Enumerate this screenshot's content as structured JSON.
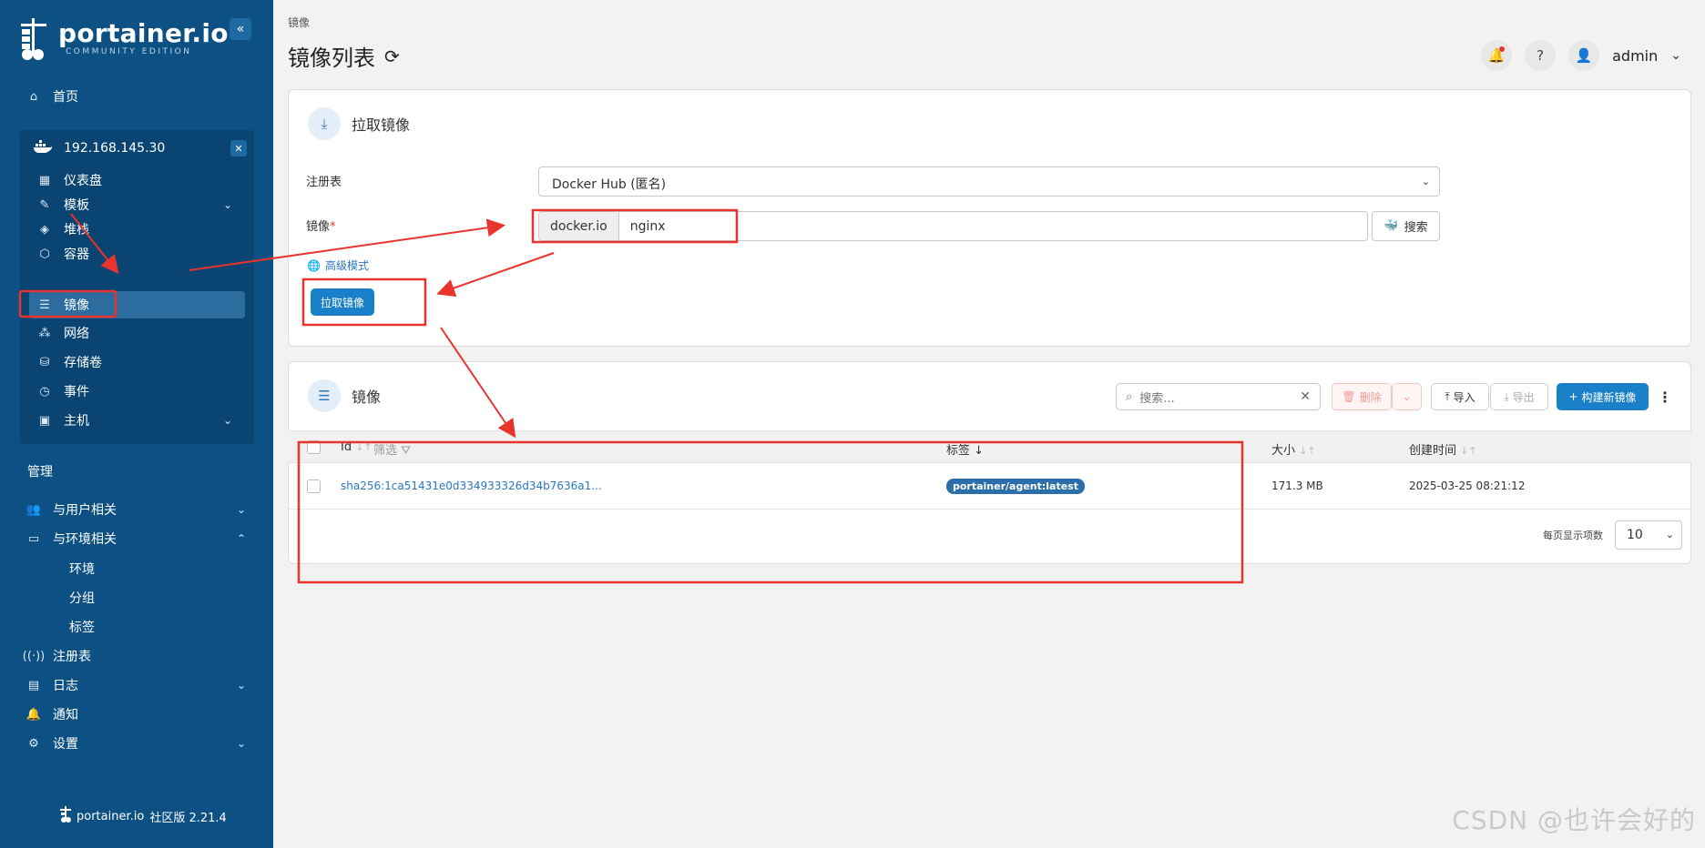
{
  "app": {
    "brand": "portainer.io",
    "edition": "COMMUNITY EDITION",
    "footer_brand": "portainer.io",
    "footer_version": "社区版 2.21.4"
  },
  "sidebar": {
    "home": "首页",
    "environment": {
      "name": "192.168.145.30",
      "items": [
        {
          "label": "仪表盘",
          "icon": "dashboard-icon"
        },
        {
          "label": "模板",
          "icon": "edit-icon",
          "expandable": true
        },
        {
          "label": "堆栈",
          "icon": "layers-icon"
        },
        {
          "label": "容器",
          "icon": "box-icon"
        },
        {
          "label": "镜像",
          "icon": "list-icon",
          "active": true
        },
        {
          "label": "网络",
          "icon": "network-icon"
        },
        {
          "label": "存储卷",
          "icon": "database-icon"
        },
        {
          "label": "事件",
          "icon": "clock-icon"
        },
        {
          "label": "主机",
          "icon": "host-icon",
          "expandable": true
        }
      ]
    },
    "admin_section": "管理",
    "admin_items": [
      {
        "label": "与用户相关",
        "icon": "users-icon",
        "expandable": true
      },
      {
        "label": "与环境相关",
        "icon": "drive-icon",
        "expanded": true
      },
      {
        "label": "注册表",
        "icon": "radio-icon"
      },
      {
        "label": "日志",
        "icon": "file-icon",
        "expandable": true
      },
      {
        "label": "通知",
        "icon": "bell-icon"
      },
      {
        "label": "设置",
        "icon": "gear-icon",
        "expandable": true
      }
    ],
    "env_sub_items": [
      "环境",
      "分组",
      "标签"
    ]
  },
  "header": {
    "breadcrumb": "镜像",
    "title": "镜像列表",
    "user": "admin"
  },
  "pull_card": {
    "title": "拉取镜像",
    "registry_label": "注册表",
    "registry_value": "Docker Hub (匿名)",
    "image_label": "镜像",
    "required_mark": "*",
    "image_prefix": "docker.io",
    "image_value": "nginx",
    "search_button": "搜索",
    "advanced_mode": "高级模式",
    "pull_button": "拉取镜像"
  },
  "images_card": {
    "title": "镜像",
    "search_placeholder": "搜索...",
    "delete_button": "删除",
    "import_button": "导入",
    "export_button": "导出",
    "build_button": "构建新镜像",
    "columns": {
      "id": "Id",
      "filter": "筛选",
      "tags": "标签",
      "size": "大小",
      "created": "创建时间"
    },
    "rows": [
      {
        "id": "sha256:1ca51431e0d334933326d34b7636a1...",
        "tag": "portainer/agent:latest",
        "size": "171.3 MB",
        "created": "2025-03-25 08:21:12"
      }
    ],
    "page_size_label": "每页显示项数",
    "page_size": "10"
  },
  "watermark": "CSDN @也许会好的",
  "colors": {
    "sidebar": "#0d5184",
    "primary": "#1a81c8",
    "annotation": "#e8342c"
  }
}
